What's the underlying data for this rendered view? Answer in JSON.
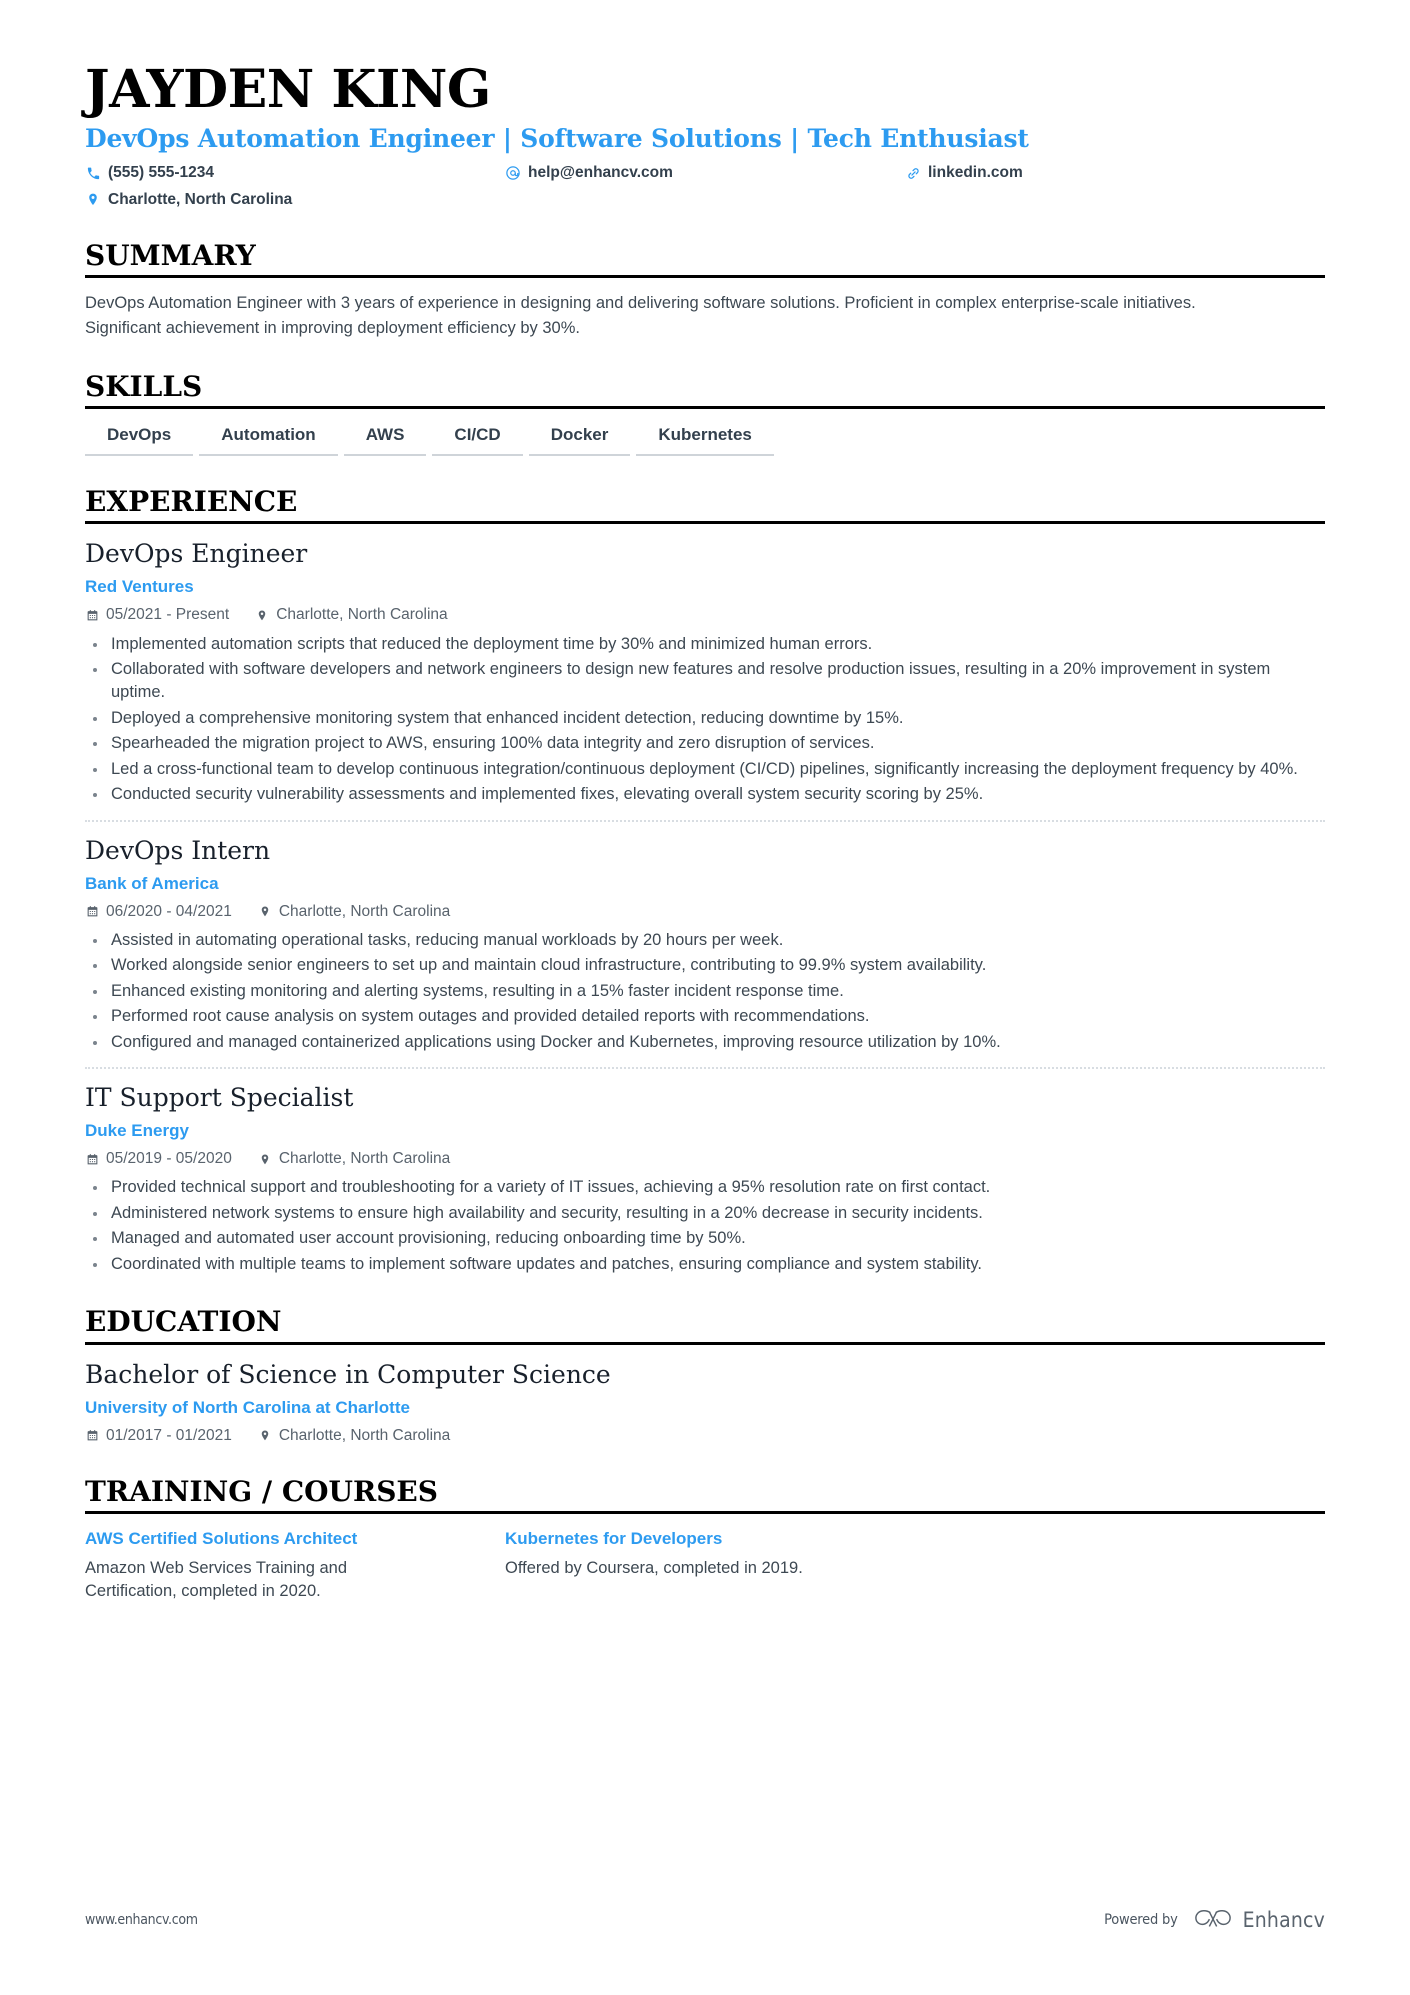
{
  "theme": {
    "accent_blue": "#2d9bf0",
    "text_dark": "#33404d",
    "body_text": "#3d4852",
    "muted": "#59636d",
    "rule_black": "#000000",
    "chip_underline": "#cfd4d9",
    "divider": "#d8dde2"
  },
  "header": {
    "name": "JAYDEN KING",
    "headline": "DevOps Automation Engineer | Software Solutions | Tech Enthusiast",
    "contacts": [
      {
        "icon": "phone-icon",
        "label": "(555) 555-1234"
      },
      {
        "icon": "email-icon",
        "label": "help@enhancv.com"
      },
      {
        "icon": "link-icon",
        "label": "linkedin.com"
      },
      {
        "icon": "location-icon",
        "label": "Charlotte, North Carolina"
      }
    ]
  },
  "sections": {
    "summary": {
      "title": "SUMMARY",
      "text": "DevOps Automation Engineer with 3 years of experience in designing and delivering software solutions. Proficient in complex enterprise-scale initiatives. Significant achievement in improving deployment efficiency by 30%."
    },
    "skills": {
      "title": "SKILLS",
      "items": [
        "DevOps",
        "Automation",
        "AWS",
        "CI/CD",
        "Docker",
        "Kubernetes"
      ]
    },
    "experience": {
      "title": "EXPERIENCE",
      "entries": [
        {
          "role": "DevOps Engineer",
          "company": "Red Ventures",
          "dates": "05/2021 - Present",
          "location": "Charlotte, North Carolina",
          "bullets": [
            "Implemented automation scripts that reduced the deployment time by 30% and minimized human errors.",
            "Collaborated with software developers and network engineers to design new features and resolve production issues, resulting in a 20% improvement in system uptime.",
            "Deployed a comprehensive monitoring system that enhanced incident detection, reducing downtime by 15%.",
            "Spearheaded the migration project to AWS, ensuring 100% data integrity and zero disruption of services.",
            "Led a cross-functional team to develop continuous integration/continuous deployment (CI/CD) pipelines, significantly increasing the deployment frequency by 40%.",
            "Conducted security vulnerability assessments and implemented fixes, elevating overall system security scoring by 25%."
          ]
        },
        {
          "role": "DevOps Intern",
          "company": "Bank of America",
          "dates": "06/2020 - 04/2021",
          "location": "Charlotte, North Carolina",
          "bullets": [
            "Assisted in automating operational tasks, reducing manual workloads by 20 hours per week.",
            "Worked alongside senior engineers to set up and maintain cloud infrastructure, contributing to 99.9% system availability.",
            "Enhanced existing monitoring and alerting systems, resulting in a 15% faster incident response time.",
            "Performed root cause analysis on system outages and provided detailed reports with recommendations.",
            "Configured and managed containerized applications using Docker and Kubernetes, improving resource utilization by 10%."
          ]
        },
        {
          "role": "IT Support Specialist",
          "company": "Duke Energy",
          "dates": "05/2019 - 05/2020",
          "location": "Charlotte, North Carolina",
          "bullets": [
            "Provided technical support and troubleshooting for a variety of IT issues, achieving a 95% resolution rate on first contact.",
            "Administered network systems to ensure high availability and security, resulting in a 20% decrease in security incidents.",
            "Managed and automated user account provisioning, reducing onboarding time by 50%.",
            "Coordinated with multiple teams to implement software updates and patches, ensuring compliance and system stability."
          ]
        }
      ]
    },
    "education": {
      "title": "EDUCATION",
      "entries": [
        {
          "degree": "Bachelor of Science in Computer Science",
          "school": "University of North Carolina at Charlotte",
          "dates": "01/2017 - 01/2021",
          "location": "Charlotte, North Carolina"
        }
      ]
    },
    "training": {
      "title": "TRAINING / COURSES",
      "courses": [
        {
          "name": "AWS Certified Solutions Architect",
          "description": "Amazon Web Services Training and Certification, completed in 2020."
        },
        {
          "name": "Kubernetes for Developers",
          "description": "Offered by Coursera, completed in 2019."
        }
      ]
    }
  },
  "footer": {
    "site": "www.enhancv.com",
    "powered_by": "Powered by",
    "brand": "Enhancv"
  }
}
